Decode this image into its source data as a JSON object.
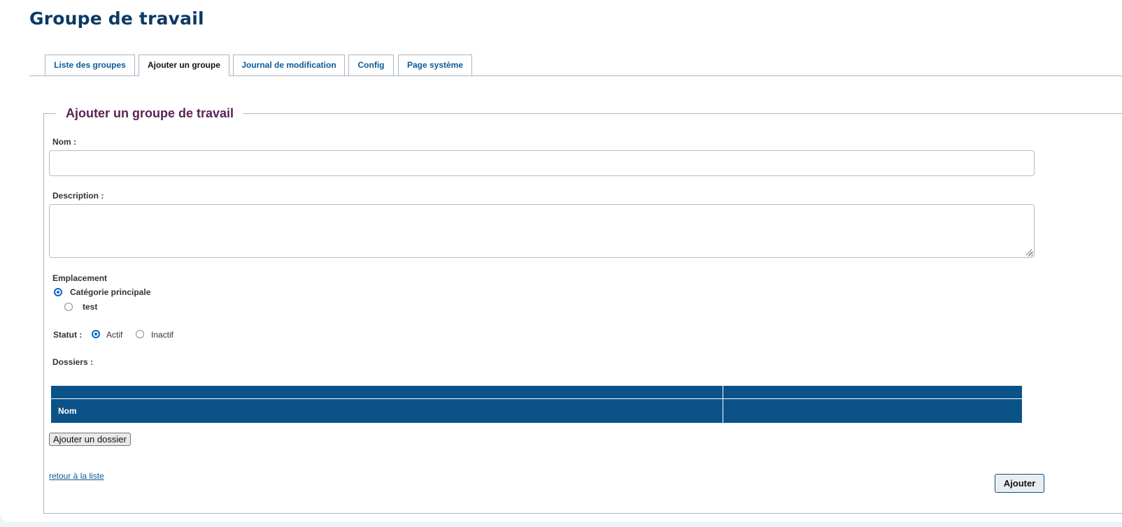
{
  "page": {
    "title": "Groupe de travail"
  },
  "tabs": [
    {
      "label": "Liste des groupes",
      "active": false
    },
    {
      "label": "Ajouter un groupe",
      "active": true
    },
    {
      "label": "Journal de modification",
      "active": false
    },
    {
      "label": "Config",
      "active": false
    },
    {
      "label": "Page système",
      "active": false
    }
  ],
  "form": {
    "legend": "Ajouter un groupe de travail",
    "name_label": "Nom :",
    "name_value": "",
    "description_label": "Description :",
    "description_value": "",
    "location_label": "Emplacement",
    "location_options": [
      {
        "label": "Catégorie principale",
        "selected": true
      },
      {
        "label": "test",
        "selected": false
      }
    ],
    "status_label": "Statut :",
    "status_options": [
      {
        "label": "Actif",
        "selected": true
      },
      {
        "label": "Inactif",
        "selected": false
      }
    ],
    "folders_label": "Dossiers :",
    "folders_table": {
      "columns": [
        "Nom",
        ""
      ],
      "rows": []
    },
    "add_folder_button": "Ajouter un dossier",
    "back_link": "retour à la liste",
    "submit_button": "Ajouter"
  },
  "colors": {
    "title": "#0b3a63",
    "tab_link": "#0b5a99",
    "legend": "#5a2356",
    "table_header": "#0b5289",
    "radio_selected": "#0a62c9"
  }
}
